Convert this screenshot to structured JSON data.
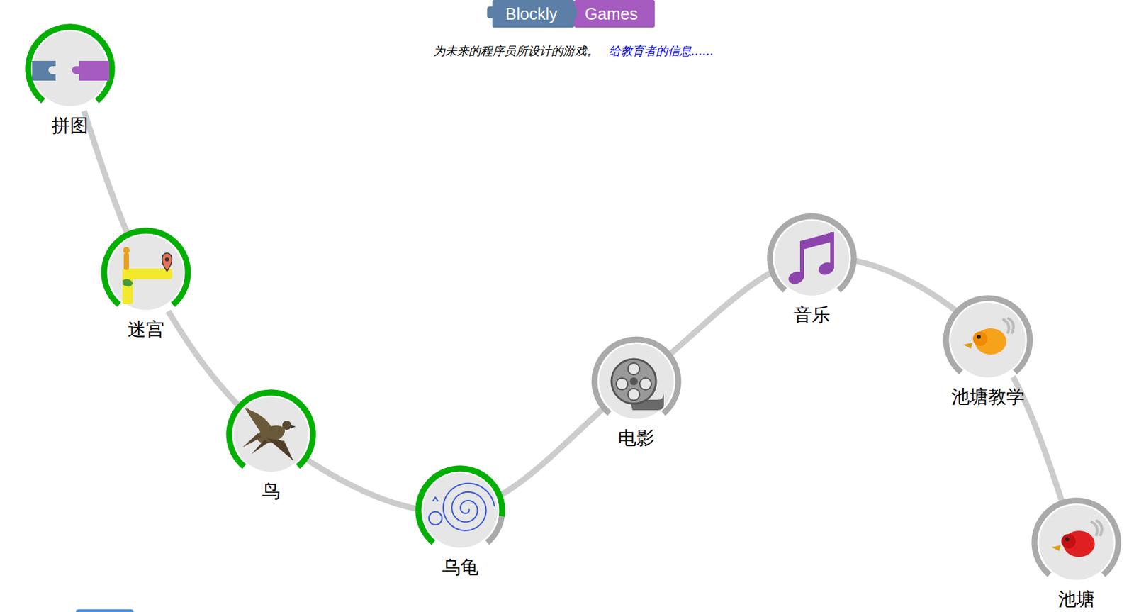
{
  "header": {
    "logo": [
      "Blockly",
      "Games"
    ],
    "tagline": "为未来的程序员所设计的游戏。",
    "link": "给教育者的信息......"
  },
  "games": [
    {
      "label": "拼图",
      "level": 1
    },
    {
      "label": "迷宫",
      "level": 1
    },
    {
      "label": "鸟",
      "level": 1
    },
    {
      "label": "乌龟",
      "level": 0.85
    },
    {
      "label": "电影",
      "level": 0
    },
    {
      "label": "音乐",
      "level": 0
    },
    {
      "label": "池塘教学",
      "level": 0
    },
    {
      "label": "池塘",
      "level": 0
    }
  ]
}
